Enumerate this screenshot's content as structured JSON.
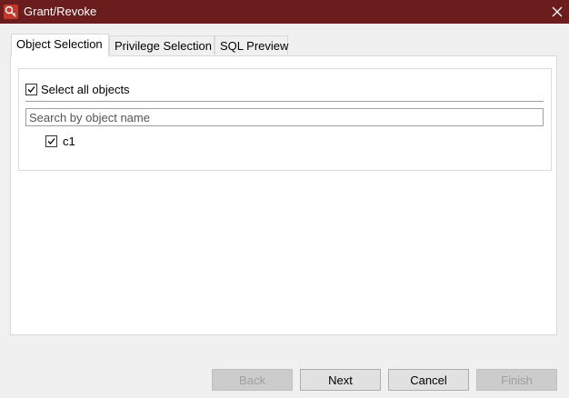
{
  "window": {
    "title": "Grant/Revoke"
  },
  "tabs": [
    {
      "label": "Object Selection",
      "active": true
    },
    {
      "label": "Privilege Selection",
      "active": false
    },
    {
      "label": "SQL Preview",
      "active": false
    }
  ],
  "objects": {
    "select_all_label": "Select all objects",
    "select_all_checked": true,
    "search_placeholder": "Search by object name",
    "search_value": "",
    "items": [
      {
        "label": "c1",
        "checked": true
      }
    ]
  },
  "buttons": {
    "back": "Back",
    "next": "Next",
    "cancel": "Cancel",
    "finish": "Finish"
  },
  "colors": {
    "titlebar": "#6b1c1c",
    "app_icon": "#c0392b"
  },
  "icons": {
    "app": "database-key-icon",
    "close": "close-icon",
    "check": "checkmark-icon"
  }
}
